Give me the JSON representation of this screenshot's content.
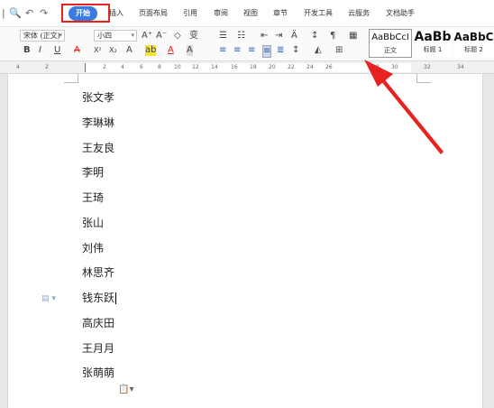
{
  "tabs": [
    {
      "label": "开始",
      "active": true
    },
    {
      "label": "插入",
      "active": false
    },
    {
      "label": "页面布局",
      "active": false
    },
    {
      "label": "引用",
      "active": false
    },
    {
      "label": "审阅",
      "active": false
    },
    {
      "label": "视图",
      "active": false
    },
    {
      "label": "章节",
      "active": false
    },
    {
      "label": "开发工具",
      "active": false
    },
    {
      "label": "云服务",
      "active": false
    },
    {
      "label": "文档助手",
      "active": false
    }
  ],
  "quick_access": {
    "preview": "🔍",
    "undo": "↶",
    "redo": "↷"
  },
  "toolbar": {
    "font_name": "宋体 (正文)",
    "font_size": "小四",
    "bold": "B",
    "italic": "I",
    "underline": "U",
    "strike": "A",
    "superscript": "X²",
    "subscript": "X₂",
    "clear_format": "A",
    "highlight": "ab",
    "font_color": "A",
    "char_shading": "A",
    "grow_font": "A⁺",
    "shrink_font": "A⁻",
    "pinyin": "变"
  },
  "styles": [
    {
      "sample": "AaBbCcI",
      "name": "正文"
    },
    {
      "sample": "AaBb",
      "name": "标题 1"
    },
    {
      "sample": "AaBbC",
      "name": "标题 2"
    }
  ],
  "ruler": {
    "labels": [
      "4",
      "2",
      "2",
      "4",
      "6",
      "8",
      "10",
      "12",
      "14",
      "16",
      "18",
      "20",
      "22",
      "24",
      "26",
      "28",
      "30",
      "32",
      "34"
    ]
  },
  "document": {
    "lines": [
      "张文孝",
      "李琳琳",
      "王友良",
      "李明",
      "王琦",
      "张山",
      "刘伟",
      "林思齐",
      "钱东跃",
      "高庆田",
      "王月月",
      "张萌萌"
    ]
  },
  "colors": {
    "accent": "#3b7be0",
    "highlight_box": "#e8221f",
    "arrow": "#e8221f"
  }
}
